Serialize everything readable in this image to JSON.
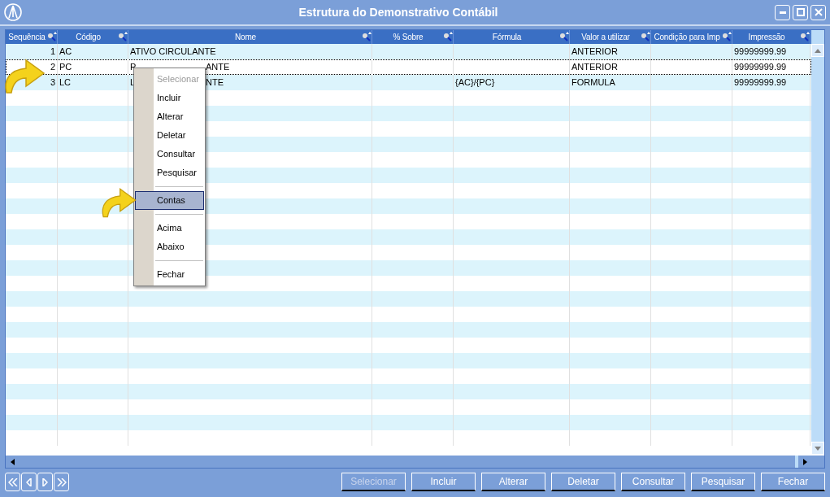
{
  "window": {
    "title": "Estrutura do Demonstrativo Contábil"
  },
  "table": {
    "columns": [
      "Sequência",
      "Código",
      "Nome",
      "% Sobre",
      "Fórmula",
      "Valor a utilizar",
      "Condição para Imp",
      "Impressão"
    ],
    "rows": [
      {
        "cells": [
          "1",
          "AC",
          "ATIVO CIRCULANTE",
          "",
          "",
          "ANTERIOR",
          "",
          "99999999.99"
        ],
        "selected": false
      },
      {
        "cells": [
          "2",
          "PC",
          [
            "P",
            "ANTE"
          ],
          "",
          "",
          "ANTERIOR",
          "",
          "99999999.99"
        ],
        "selected": true
      },
      {
        "cells": [
          "3",
          "LC",
          [
            "L",
            "NTE"
          ],
          "",
          "{AC}/{PC}",
          "FORMULA",
          "",
          "99999999.99"
        ],
        "selected": false
      }
    ]
  },
  "context_menu": {
    "items": [
      {
        "kind": "item",
        "label": "Selecionar",
        "disabled": true,
        "selected": false
      },
      {
        "kind": "item",
        "label": "Incluir",
        "disabled": false,
        "selected": false
      },
      {
        "kind": "item",
        "label": "Alterar",
        "disabled": false,
        "selected": false
      },
      {
        "kind": "item",
        "label": "Deletar",
        "disabled": false,
        "selected": false
      },
      {
        "kind": "item",
        "label": "Consultar",
        "disabled": false,
        "selected": false
      },
      {
        "kind": "item",
        "label": "Pesquisar",
        "disabled": false,
        "selected": false
      },
      {
        "kind": "separator"
      },
      {
        "kind": "item",
        "label": "Contas",
        "disabled": false,
        "selected": true
      },
      {
        "kind": "separator"
      },
      {
        "kind": "item",
        "label": "Acima",
        "disabled": false,
        "selected": false
      },
      {
        "kind": "item",
        "label": "Abaixo",
        "disabled": false,
        "selected": false
      },
      {
        "kind": "separator"
      },
      {
        "kind": "item",
        "label": "Fechar",
        "disabled": false,
        "selected": false
      }
    ]
  },
  "buttons": [
    {
      "label": "Selecionar",
      "disabled": true
    },
    {
      "label": "Incluir",
      "disabled": false
    },
    {
      "label": "Alterar",
      "disabled": false
    },
    {
      "label": "Deletar",
      "disabled": false
    },
    {
      "label": "Consultar",
      "disabled": false
    },
    {
      "label": "Pesquisar",
      "disabled": false
    },
    {
      "label": "Fechar",
      "disabled": false
    }
  ]
}
